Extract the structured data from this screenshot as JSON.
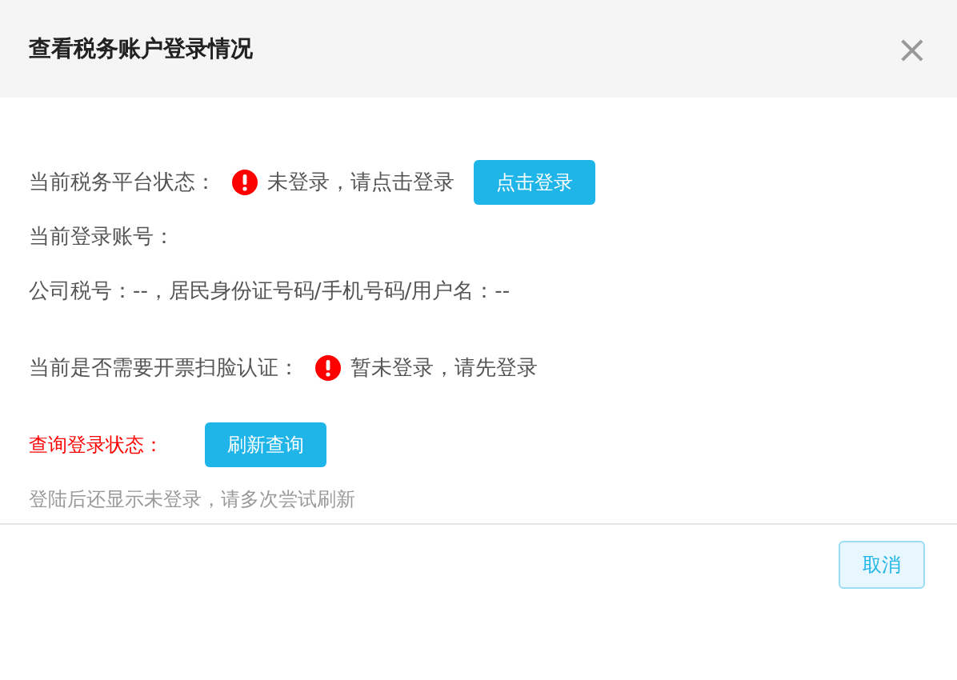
{
  "dialog": {
    "title": "查看税务账户登录情况",
    "close": "×"
  },
  "rows": [
    {
      "kind": "status",
      "label": "当前税务平台状态：",
      "status": "未登录，请点击登录",
      "button": "点击登录"
    },
    {
      "kind": "text",
      "label": "当前登录账号："
    },
    {
      "kind": "text",
      "label": "公司税号：--，居民身份证号码/手机号码/用户名：--"
    },
    {
      "kind": "status",
      "label": "当前是否需要开票扫脸认证：",
      "status": "暂未登录，请先登录"
    },
    {
      "kind": "query",
      "label": "查询登录状态：",
      "button": "刷新查询"
    },
    {
      "kind": "hint",
      "label": "登陆后还显示未登录，请多次尝试刷新"
    }
  ],
  "footer": {
    "buttons": [
      "取消"
    ]
  }
}
